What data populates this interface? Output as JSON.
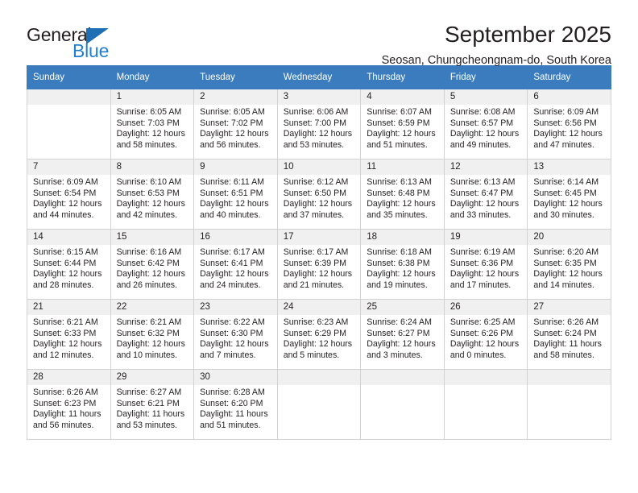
{
  "brand": {
    "name_part1": "General",
    "name_part2": "Blue",
    "accent_color": "#1f7fd0",
    "triangle_color": "#1f6fb5"
  },
  "header": {
    "title": "September 2025",
    "subtitle": "Seosan, Chungcheongnam-do, South Korea"
  },
  "calendar": {
    "header_background": "#3a7cbe",
    "daynum_background": "#f0f0f0",
    "weekday_headers": [
      "Sunday",
      "Monday",
      "Tuesday",
      "Wednesday",
      "Thursday",
      "Friday",
      "Saturday"
    ],
    "weeks": [
      [
        {
          "day": "",
          "empty": true,
          "sunrise": "",
          "sunset": "",
          "daylight": ""
        },
        {
          "day": "1",
          "sunrise": "Sunrise: 6:05 AM",
          "sunset": "Sunset: 7:03 PM",
          "daylight": "Daylight: 12 hours and 58 minutes."
        },
        {
          "day": "2",
          "sunrise": "Sunrise: 6:05 AM",
          "sunset": "Sunset: 7:02 PM",
          "daylight": "Daylight: 12 hours and 56 minutes."
        },
        {
          "day": "3",
          "sunrise": "Sunrise: 6:06 AM",
          "sunset": "Sunset: 7:00 PM",
          "daylight": "Daylight: 12 hours and 53 minutes."
        },
        {
          "day": "4",
          "sunrise": "Sunrise: 6:07 AM",
          "sunset": "Sunset: 6:59 PM",
          "daylight": "Daylight: 12 hours and 51 minutes."
        },
        {
          "day": "5",
          "sunrise": "Sunrise: 6:08 AM",
          "sunset": "Sunset: 6:57 PM",
          "daylight": "Daylight: 12 hours and 49 minutes."
        },
        {
          "day": "6",
          "sunrise": "Sunrise: 6:09 AM",
          "sunset": "Sunset: 6:56 PM",
          "daylight": "Daylight: 12 hours and 47 minutes."
        }
      ],
      [
        {
          "day": "7",
          "sunrise": "Sunrise: 6:09 AM",
          "sunset": "Sunset: 6:54 PM",
          "daylight": "Daylight: 12 hours and 44 minutes."
        },
        {
          "day": "8",
          "sunrise": "Sunrise: 6:10 AM",
          "sunset": "Sunset: 6:53 PM",
          "daylight": "Daylight: 12 hours and 42 minutes."
        },
        {
          "day": "9",
          "sunrise": "Sunrise: 6:11 AM",
          "sunset": "Sunset: 6:51 PM",
          "daylight": "Daylight: 12 hours and 40 minutes."
        },
        {
          "day": "10",
          "sunrise": "Sunrise: 6:12 AM",
          "sunset": "Sunset: 6:50 PM",
          "daylight": "Daylight: 12 hours and 37 minutes."
        },
        {
          "day": "11",
          "sunrise": "Sunrise: 6:13 AM",
          "sunset": "Sunset: 6:48 PM",
          "daylight": "Daylight: 12 hours and 35 minutes."
        },
        {
          "day": "12",
          "sunrise": "Sunrise: 6:13 AM",
          "sunset": "Sunset: 6:47 PM",
          "daylight": "Daylight: 12 hours and 33 minutes."
        },
        {
          "day": "13",
          "sunrise": "Sunrise: 6:14 AM",
          "sunset": "Sunset: 6:45 PM",
          "daylight": "Daylight: 12 hours and 30 minutes."
        }
      ],
      [
        {
          "day": "14",
          "sunrise": "Sunrise: 6:15 AM",
          "sunset": "Sunset: 6:44 PM",
          "daylight": "Daylight: 12 hours and 28 minutes."
        },
        {
          "day": "15",
          "sunrise": "Sunrise: 6:16 AM",
          "sunset": "Sunset: 6:42 PM",
          "daylight": "Daylight: 12 hours and 26 minutes."
        },
        {
          "day": "16",
          "sunrise": "Sunrise: 6:17 AM",
          "sunset": "Sunset: 6:41 PM",
          "daylight": "Daylight: 12 hours and 24 minutes."
        },
        {
          "day": "17",
          "sunrise": "Sunrise: 6:17 AM",
          "sunset": "Sunset: 6:39 PM",
          "daylight": "Daylight: 12 hours and 21 minutes."
        },
        {
          "day": "18",
          "sunrise": "Sunrise: 6:18 AM",
          "sunset": "Sunset: 6:38 PM",
          "daylight": "Daylight: 12 hours and 19 minutes."
        },
        {
          "day": "19",
          "sunrise": "Sunrise: 6:19 AM",
          "sunset": "Sunset: 6:36 PM",
          "daylight": "Daylight: 12 hours and 17 minutes."
        },
        {
          "day": "20",
          "sunrise": "Sunrise: 6:20 AM",
          "sunset": "Sunset: 6:35 PM",
          "daylight": "Daylight: 12 hours and 14 minutes."
        }
      ],
      [
        {
          "day": "21",
          "sunrise": "Sunrise: 6:21 AM",
          "sunset": "Sunset: 6:33 PM",
          "daylight": "Daylight: 12 hours and 12 minutes."
        },
        {
          "day": "22",
          "sunrise": "Sunrise: 6:21 AM",
          "sunset": "Sunset: 6:32 PM",
          "daylight": "Daylight: 12 hours and 10 minutes."
        },
        {
          "day": "23",
          "sunrise": "Sunrise: 6:22 AM",
          "sunset": "Sunset: 6:30 PM",
          "daylight": "Daylight: 12 hours and 7 minutes."
        },
        {
          "day": "24",
          "sunrise": "Sunrise: 6:23 AM",
          "sunset": "Sunset: 6:29 PM",
          "daylight": "Daylight: 12 hours and 5 minutes."
        },
        {
          "day": "25",
          "sunrise": "Sunrise: 6:24 AM",
          "sunset": "Sunset: 6:27 PM",
          "daylight": "Daylight: 12 hours and 3 minutes."
        },
        {
          "day": "26",
          "sunrise": "Sunrise: 6:25 AM",
          "sunset": "Sunset: 6:26 PM",
          "daylight": "Daylight: 12 hours and 0 minutes."
        },
        {
          "day": "27",
          "sunrise": "Sunrise: 6:26 AM",
          "sunset": "Sunset: 6:24 PM",
          "daylight": "Daylight: 11 hours and 58 minutes."
        }
      ],
      [
        {
          "day": "28",
          "sunrise": "Sunrise: 6:26 AM",
          "sunset": "Sunset: 6:23 PM",
          "daylight": "Daylight: 11 hours and 56 minutes."
        },
        {
          "day": "29",
          "sunrise": "Sunrise: 6:27 AM",
          "sunset": "Sunset: 6:21 PM",
          "daylight": "Daylight: 11 hours and 53 minutes."
        },
        {
          "day": "30",
          "sunrise": "Sunrise: 6:28 AM",
          "sunset": "Sunset: 6:20 PM",
          "daylight": "Daylight: 11 hours and 51 minutes."
        },
        {
          "day": "",
          "empty": true,
          "sunrise": "",
          "sunset": "",
          "daylight": ""
        },
        {
          "day": "",
          "empty": true,
          "sunrise": "",
          "sunset": "",
          "daylight": ""
        },
        {
          "day": "",
          "empty": true,
          "sunrise": "",
          "sunset": "",
          "daylight": ""
        },
        {
          "day": "",
          "empty": true,
          "sunrise": "",
          "sunset": "",
          "daylight": ""
        }
      ]
    ]
  }
}
